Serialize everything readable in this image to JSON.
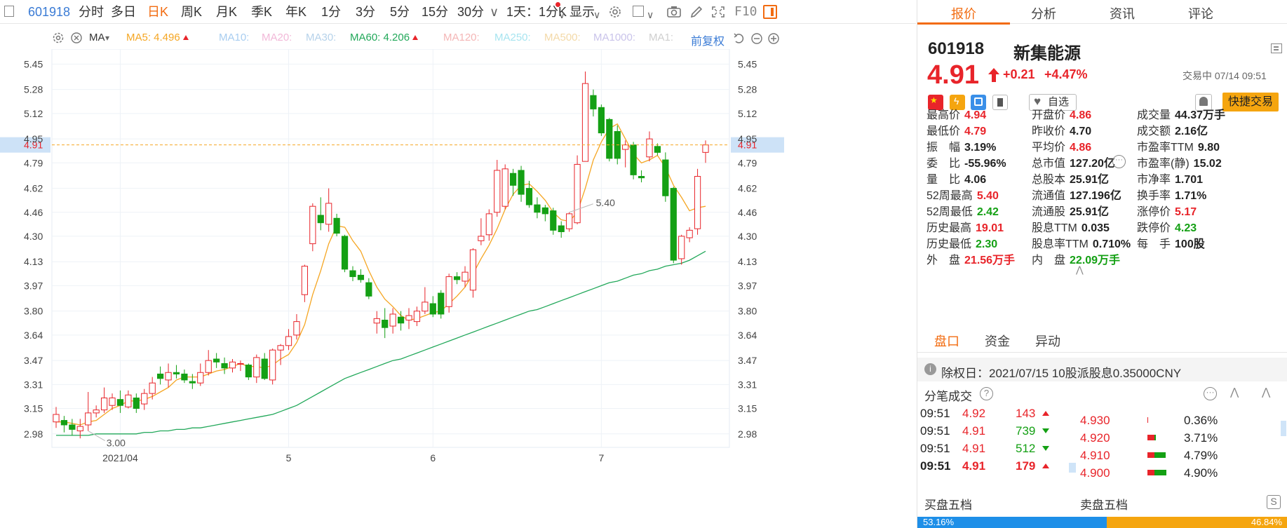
{
  "toolbar": {
    "code": "601918",
    "periods": [
      "分时",
      "多日",
      "日K",
      "周K",
      "月K",
      "季K",
      "年K",
      "1分",
      "3分",
      "5分",
      "15分",
      "30分"
    ],
    "active_period": "日K",
    "interval_select": "1天：1分K",
    "display_select": "显示",
    "f10": "F10"
  },
  "ma_bar": {
    "ma_label": "MA",
    "ma5": "MA5: 4.496",
    "ma10": "MA10:",
    "ma20": "MA20:",
    "ma30": "MA30:",
    "ma60": "MA60: 4.206",
    "ma120": "MA120:",
    "ma250": "MA250:",
    "ma500": "MA500:",
    "ma1000": "MA1000:",
    "ma1": "MA1:",
    "adjust": "前复权",
    "colors": {
      "ma5": "#f5a623",
      "ma10": "#a8cdf0",
      "ma20": "#f2b8d8",
      "ma30": "#b6d2ea",
      "ma60": "#22a85a",
      "ma120": "#f4b6b6",
      "ma250": "#a7e4f0",
      "ma500": "#f3d9a8",
      "ma1000": "#c9c3ea",
      "ma1": "#cfcfcf"
    }
  },
  "chart_data": {
    "type": "candlestick",
    "y_ticks": [
      2.98,
      3.15,
      3.31,
      3.47,
      3.64,
      3.8,
      3.97,
      4.13,
      4.3,
      4.46,
      4.62,
      4.79,
      4.95,
      5.12,
      5.28,
      5.45
    ],
    "ylim": [
      2.89,
      5.55
    ],
    "x_labels": [
      "2021/04",
      "5",
      "6",
      "7"
    ],
    "x_label_index": [
      8,
      29,
      47,
      68
    ],
    "current_price": 4.91,
    "current_price_label": "4.91",
    "high_label": "5.40",
    "low_label": "3.00",
    "high_index": 64,
    "low_index": 4,
    "candles": [
      [
        3.06,
        3.11,
        3.16,
        3.02
      ],
      [
        3.07,
        3.04,
        3.1,
        2.99
      ],
      [
        3.04,
        3.01,
        3.08,
        2.97
      ],
      [
        3.0,
        3.03,
        3.08,
        2.95
      ],
      [
        3.04,
        3.12,
        3.26,
        3.0
      ],
      [
        3.12,
        3.14,
        3.17,
        3.09
      ],
      [
        3.14,
        3.22,
        3.29,
        3.12
      ],
      [
        3.17,
        3.22,
        3.25,
        3.14
      ],
      [
        3.21,
        3.17,
        3.27,
        3.12
      ],
      [
        3.16,
        3.24,
        3.27,
        3.15
      ],
      [
        3.22,
        3.15,
        3.25,
        3.12
      ],
      [
        3.18,
        3.25,
        3.28,
        3.14
      ],
      [
        3.25,
        3.32,
        3.36,
        3.21
      ],
      [
        3.38,
        3.35,
        3.43,
        3.31
      ],
      [
        3.34,
        3.39,
        3.45,
        3.29
      ],
      [
        3.39,
        3.38,
        3.44,
        3.35
      ],
      [
        3.38,
        3.34,
        3.41,
        3.32
      ],
      [
        3.33,
        3.32,
        3.38,
        3.28
      ],
      [
        3.32,
        3.39,
        3.45,
        3.3
      ],
      [
        3.39,
        3.47,
        3.54,
        3.37
      ],
      [
        3.48,
        3.46,
        3.52,
        3.42
      ],
      [
        3.45,
        3.42,
        3.49,
        3.38
      ],
      [
        3.42,
        3.46,
        3.48,
        3.39
      ],
      [
        3.45,
        3.45,
        3.47,
        3.4
      ],
      [
        3.44,
        3.36,
        3.45,
        3.34
      ],
      [
        3.36,
        3.49,
        3.51,
        3.32
      ],
      [
        3.48,
        3.35,
        3.52,
        3.34
      ],
      [
        3.34,
        3.54,
        3.55,
        3.31
      ],
      [
        3.54,
        3.57,
        3.58,
        3.44
      ],
      [
        3.57,
        3.63,
        3.68,
        3.54
      ],
      [
        3.64,
        3.73,
        3.78,
        3.61
      ],
      [
        3.91,
        4.1,
        4.11,
        3.86
      ],
      [
        4.25,
        4.5,
        4.52,
        4.2
      ],
      [
        4.44,
        4.39,
        4.56,
        4.34
      ],
      [
        4.38,
        4.52,
        4.62,
        4.33
      ],
      [
        4.42,
        4.32,
        4.45,
        4.3
      ],
      [
        4.3,
        4.08,
        4.31,
        4.06
      ],
      [
        4.07,
        4.03,
        4.1,
        4.0
      ],
      [
        4.04,
        4.01,
        4.08,
        3.99
      ],
      [
        3.99,
        3.9,
        4.02,
        3.88
      ],
      [
        3.72,
        3.75,
        3.8,
        3.65
      ],
      [
        3.74,
        3.69,
        3.82,
        3.62
      ],
      [
        3.7,
        3.78,
        3.82,
        3.65
      ],
      [
        3.76,
        3.72,
        3.8,
        3.67
      ],
      [
        3.74,
        3.77,
        3.82,
        3.68
      ],
      [
        3.73,
        3.8,
        3.83,
        3.7
      ],
      [
        3.8,
        3.86,
        3.96,
        3.78
      ],
      [
        3.85,
        3.78,
        3.9,
        3.76
      ],
      [
        3.92,
        3.78,
        3.94,
        3.75
      ],
      [
        3.83,
        4.03,
        4.05,
        3.79
      ],
      [
        4.03,
        4.01,
        4.06,
        3.98
      ],
      [
        4.0,
        4.06,
        4.1,
        3.96
      ],
      [
        3.94,
        4.21,
        4.22,
        3.89
      ],
      [
        4.27,
        4.3,
        4.42,
        4.24
      ],
      [
        4.31,
        4.45,
        4.48,
        4.27
      ],
      [
        4.46,
        4.74,
        4.81,
        4.43
      ],
      [
        4.5,
        4.75,
        4.78,
        4.48
      ],
      [
        4.72,
        4.64,
        4.75,
        4.57
      ],
      [
        4.74,
        4.58,
        4.77,
        4.53
      ],
      [
        4.62,
        4.51,
        4.67,
        4.49
      ],
      [
        4.51,
        4.46,
        4.56,
        4.42
      ],
      [
        4.49,
        4.45,
        4.51,
        4.4
      ],
      [
        4.47,
        4.34,
        4.49,
        4.31
      ],
      [
        4.37,
        4.33,
        4.4,
        4.29
      ],
      [
        4.35,
        4.45,
        4.46,
        4.33
      ],
      [
        4.39,
        4.78,
        4.84,
        4.38
      ],
      [
        4.8,
        5.32,
        5.4,
        4.8
      ],
      [
        5.24,
        5.15,
        5.28,
        5.1
      ],
      [
        5.16,
        4.99,
        5.18,
        4.97
      ],
      [
        5.08,
        4.82,
        5.09,
        4.8
      ],
      [
        5.0,
        4.82,
        5.04,
        4.78
      ],
      [
        4.88,
        4.91,
        4.94,
        4.76
      ],
      [
        4.91,
        4.71,
        4.93,
        4.68
      ],
      [
        4.7,
        4.69,
        4.74,
        4.66
      ],
      [
        4.83,
        4.95,
        5.0,
        4.8
      ],
      [
        4.9,
        4.86,
        4.92,
        4.84
      ],
      [
        4.81,
        4.57,
        4.86,
        4.53
      ],
      [
        4.62,
        4.14,
        4.63,
        4.12
      ],
      [
        4.15,
        4.3,
        4.31,
        4.11
      ],
      [
        4.29,
        4.34,
        4.36,
        4.26
      ],
      [
        4.35,
        4.7,
        4.75,
        4.31
      ],
      [
        4.86,
        4.91,
        4.94,
        4.79
      ]
    ],
    "ma5": [
      3.06,
      3.06,
      3.05,
      3.04,
      3.06,
      3.07,
      3.11,
      3.15,
      3.17,
      3.2,
      3.2,
      3.21,
      3.23,
      3.26,
      3.29,
      3.34,
      3.36,
      3.36,
      3.36,
      3.38,
      3.4,
      3.41,
      3.43,
      3.45,
      3.43,
      3.43,
      3.42,
      3.44,
      3.48,
      3.51,
      3.59,
      3.71,
      3.91,
      4.07,
      4.25,
      4.37,
      4.36,
      4.27,
      4.2,
      4.07,
      3.96,
      3.88,
      3.83,
      3.77,
      3.74,
      3.75,
      3.77,
      3.79,
      3.8,
      3.85,
      3.9,
      3.96,
      4.05,
      4.15,
      4.24,
      4.35,
      4.48,
      4.58,
      4.64,
      4.65,
      4.6,
      4.54,
      4.46,
      4.41,
      4.4,
      4.46,
      4.62,
      4.81,
      4.93,
      5.02,
      5.05,
      4.95,
      4.85,
      4.79,
      4.81,
      4.84,
      4.76,
      4.64,
      4.56,
      4.47,
      4.49,
      4.5
    ],
    "ma60": [
      2.97,
      2.97,
      2.97,
      2.97,
      2.97,
      2.98,
      2.98,
      2.98,
      2.98,
      2.98,
      2.98,
      2.99,
      2.99,
      3.0,
      3.0,
      3.01,
      3.01,
      3.02,
      3.02,
      3.03,
      3.04,
      3.05,
      3.06,
      3.07,
      3.08,
      3.09,
      3.1,
      3.11,
      3.13,
      3.15,
      3.17,
      3.2,
      3.23,
      3.26,
      3.29,
      3.32,
      3.35,
      3.37,
      3.39,
      3.41,
      3.43,
      3.45,
      3.47,
      3.48,
      3.5,
      3.52,
      3.54,
      3.56,
      3.58,
      3.6,
      3.62,
      3.64,
      3.66,
      3.68,
      3.7,
      3.72,
      3.74,
      3.76,
      3.78,
      3.8,
      3.81,
      3.83,
      3.85,
      3.87,
      3.89,
      3.91,
      3.93,
      3.95,
      3.97,
      3.99,
      4.0,
      4.02,
      4.04,
      4.05,
      4.07,
      4.08,
      4.1,
      4.11,
      4.12,
      4.14,
      4.17,
      4.2
    ],
    "colors": {
      "up": "#e8242a",
      "down": "#14a014",
      "ma5": "#f5a623",
      "ma60": "#22a85a",
      "price_line": "#f5a623",
      "price_tag_bg": "#cde2f7"
    }
  },
  "panel": {
    "tabs": [
      "报价",
      "分析",
      "资讯",
      "评论"
    ],
    "code": "601918",
    "name": "新集能源",
    "price": "4.91",
    "change": "+0.21",
    "change_pct": "+4.47%",
    "status": "交易中 07/14 09:51",
    "watch_label": "自选",
    "fast_trade": "快捷交易",
    "quotes": [
      [
        {
          "l": "最高价",
          "v": "4.94",
          "c": "red"
        },
        {
          "l": "开盘价",
          "v": "4.86",
          "c": "red"
        },
        {
          "l": "成交量",
          "v": "44.37万手",
          "c": "dark"
        }
      ],
      [
        {
          "l": "最低价",
          "v": "4.79",
          "c": "red"
        },
        {
          "l": "昨收价",
          "v": "4.70",
          "c": "dark"
        },
        {
          "l": "成交额",
          "v": "2.16亿",
          "c": "dark"
        }
      ],
      [
        {
          "l": "振　幅",
          "v": "3.19%",
          "c": "dark"
        },
        {
          "l": "平均价",
          "v": "4.86",
          "c": "red"
        },
        {
          "l": "市盈率TTM",
          "v": "9.80",
          "c": "dark"
        }
      ],
      [
        {
          "l": "委　比",
          "v": "-55.96%",
          "c": "dark"
        },
        {
          "l": "总市值",
          "v": "127.20亿",
          "c": "dark"
        },
        {
          "l": "市盈率(静)",
          "v": "15.02",
          "c": "dark"
        }
      ],
      [
        {
          "l": "量　比",
          "v": "4.06",
          "c": "dark"
        },
        {
          "l": "总股本",
          "v": "25.91亿",
          "c": "dark"
        },
        {
          "l": "市净率",
          "v": "1.701",
          "c": "dark"
        }
      ],
      [
        {
          "l": "52周最高",
          "v": "5.40",
          "c": "red"
        },
        {
          "l": "流通值",
          "v": "127.196亿",
          "c": "dark"
        },
        {
          "l": "换手率",
          "v": "1.71%",
          "c": "dark"
        }
      ],
      [
        {
          "l": "52周最低",
          "v": "2.42",
          "c": "green"
        },
        {
          "l": "流通股",
          "v": "25.91亿",
          "c": "dark"
        },
        {
          "l": "涨停价",
          "v": "5.17",
          "c": "red"
        }
      ],
      [
        {
          "l": "历史最高",
          "v": "19.01",
          "c": "red"
        },
        {
          "l": "股息TTM",
          "v": "0.035",
          "c": "dark"
        },
        {
          "l": "跌停价",
          "v": "4.23",
          "c": "green"
        }
      ],
      [
        {
          "l": "历史最低",
          "v": "2.30",
          "c": "green"
        },
        {
          "l": "股息率TTM",
          "v": "0.710%",
          "c": "dark"
        },
        {
          "l": "每　手",
          "v": "100股",
          "c": "dark"
        }
      ],
      [
        {
          "l": "外　盘",
          "v": "21.56万手",
          "c": "red"
        },
        {
          "l": "内　盘",
          "v": "22.09万手",
          "c": "green"
        },
        null
      ]
    ],
    "subtabs": [
      "盘口",
      "资金",
      "异动"
    ],
    "notice": "除权日：2021/07/15  10股派股息0.35000CNY",
    "ticks_title": "分笔成交",
    "ticks": [
      {
        "time": "09:51",
        "price": "4.92",
        "vol": "143",
        "dir": "up"
      },
      {
        "time": "09:51",
        "price": "4.91",
        "vol": "739",
        "dir": "down"
      },
      {
        "time": "09:51",
        "price": "4.91",
        "vol": "512",
        "dir": "down"
      },
      {
        "time": "09:51",
        "price": "4.91",
        "vol": "179",
        "dir": "up"
      }
    ],
    "levels": [
      {
        "price": "4.930",
        "pct": "0.36%",
        "frac": 0.04
      },
      {
        "price": "4.920",
        "pct": "3.71%",
        "frac": 0.35
      },
      {
        "price": "4.910",
        "pct": "4.79%",
        "frac": 0.75
      },
      {
        "price": "4.900",
        "pct": "4.90%",
        "frac": 0.78
      }
    ],
    "buy_title": "买盘五档",
    "sell_title": "卖盘五档",
    "buy_pct": "53.16%",
    "sell_pct": "46.84%"
  }
}
